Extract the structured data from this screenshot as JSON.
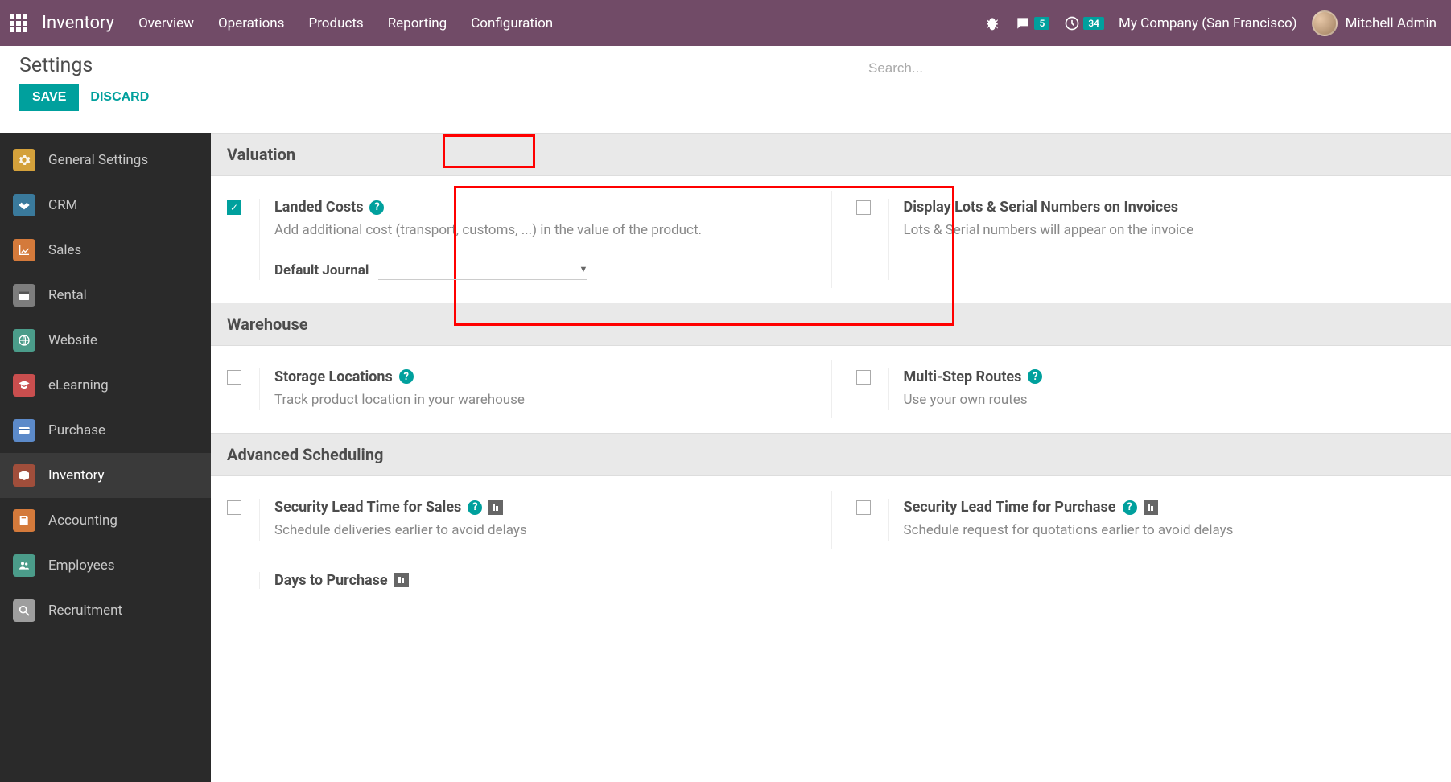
{
  "navbar": {
    "brand": "Inventory",
    "menu": [
      "Overview",
      "Operations",
      "Products",
      "Reporting",
      "Configuration"
    ],
    "messages_badge": "5",
    "activities_badge": "34",
    "company": "My Company (San Francisco)",
    "user": "Mitchell Admin"
  },
  "control": {
    "title": "Settings",
    "save": "SAVE",
    "discard": "DISCARD",
    "search_placeholder": "Search..."
  },
  "sidebar": {
    "items": [
      {
        "label": "General Settings",
        "color": "#d4a13b"
      },
      {
        "label": "CRM",
        "color": "#3a7a9c"
      },
      {
        "label": "Sales",
        "color": "#d47a3b"
      },
      {
        "label": "Rental",
        "color": "#7d7d7d"
      },
      {
        "label": "Website",
        "color": "#4b9c8a"
      },
      {
        "label": "eLearning",
        "color": "#c94e4e"
      },
      {
        "label": "Purchase",
        "color": "#5c8ac9"
      },
      {
        "label": "Inventory",
        "color": "#a04e3b"
      },
      {
        "label": "Accounting",
        "color": "#d47a3b"
      },
      {
        "label": "Employees",
        "color": "#4b9c8a"
      },
      {
        "label": "Recruitment",
        "color": "#9e9e9e"
      }
    ],
    "active_index": 7
  },
  "sections": {
    "valuation": {
      "header": "Valuation",
      "left": {
        "title": "Landed Costs",
        "desc": "Add additional cost (transport, customs, ...) in the value of the product.",
        "checked": true,
        "field_label": "Default Journal"
      },
      "right": {
        "title": "Display Lots & Serial Numbers on Invoices",
        "desc": "Lots & Serial numbers will appear on the invoice",
        "checked": false
      }
    },
    "warehouse": {
      "header": "Warehouse",
      "left": {
        "title": "Storage Locations",
        "desc": "Track product location in your warehouse",
        "checked": false
      },
      "right": {
        "title": "Multi-Step Routes",
        "desc": "Use your own routes",
        "checked": false
      }
    },
    "scheduling": {
      "header": "Advanced Scheduling",
      "left": {
        "title": "Security Lead Time for Sales",
        "desc": "Schedule deliveries earlier to avoid delays",
        "checked": false
      },
      "right": {
        "title": "Security Lead Time for Purchase",
        "desc": "Schedule request for quotations earlier to avoid delays",
        "checked": false
      },
      "extra": {
        "title": "Days to Purchase"
      }
    }
  }
}
